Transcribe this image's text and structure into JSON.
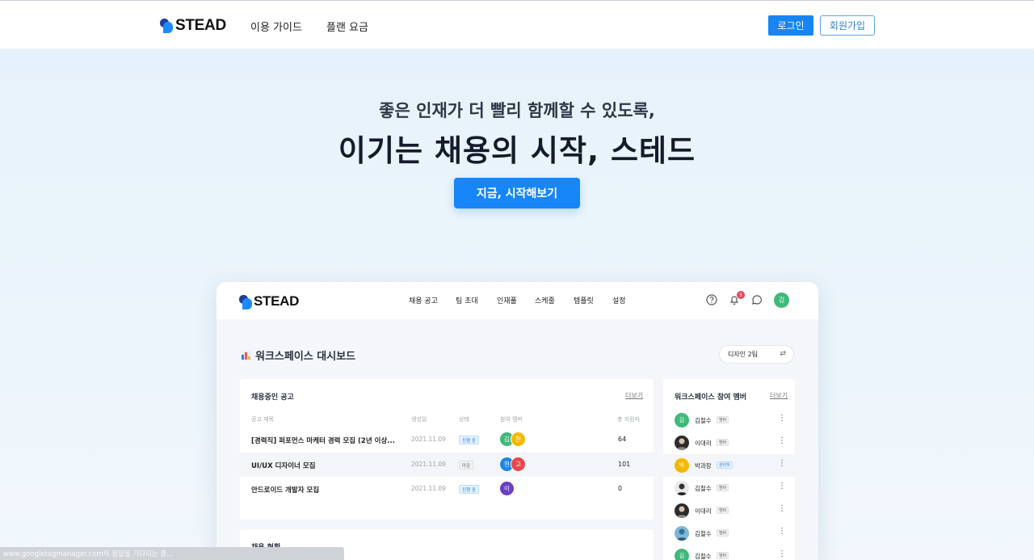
{
  "nav": {
    "logo_text": "STEAD",
    "links": [
      "이용 가이드",
      "플랜 요금"
    ],
    "login_label": "로그인",
    "signup_label": "회원가입"
  },
  "hero": {
    "subtitle": "좋은 인재가 더 빨리 함께할 수 있도록,",
    "headline": "이기는 채용의 시작, 스테드",
    "cta_label": "지금, 시작해보기"
  },
  "mockup": {
    "logo_text": "STEAD",
    "nav_links": [
      "채용 공고",
      "팀 초대",
      "인재풀",
      "스케줄",
      "템플릿",
      "설정"
    ],
    "notification_count": "5",
    "user_initial": "김",
    "dashboard_title": "워크스페이스 대시보드",
    "team_selector": "디자인 2팀",
    "jobs_card": {
      "title": "채용중인 공고",
      "more": "더보기",
      "headers": [
        "공고 제목",
        "생성일",
        "상태",
        "참여 멤버",
        "총 지원자"
      ],
      "rows": [
        {
          "title": "[경력직] 퍼포먼스 마케터 경력 모집 (2년 이상...",
          "date": "2021.11.09",
          "status": "진행 중",
          "members": [
            "김",
            "한"
          ],
          "applicants": "64"
        },
        {
          "title": "UI/UX 디자이너 모집",
          "date": "2021.11.09",
          "status": "마감",
          "members": [
            "현",
            "고"
          ],
          "applicants": "101"
        },
        {
          "title": "안드로이드 개발자 모집",
          "date": "2021.11.09",
          "status": "진행 중",
          "members": [
            "이"
          ],
          "applicants": "0"
        }
      ]
    },
    "members_card": {
      "title": "워크스페이스 참여 멤버",
      "more": "더보기",
      "members": [
        {
          "name": "김철수",
          "role": "멤버",
          "initial": "김"
        },
        {
          "name": "이대리",
          "role": "멤버",
          "initial": ""
        },
        {
          "name": "박과장",
          "role": "관리자",
          "initial": "박"
        },
        {
          "name": "김철수",
          "role": "멤버",
          "initial": ""
        },
        {
          "name": "이대리",
          "role": "멤버",
          "initial": ""
        },
        {
          "name": "김철수",
          "role": "멤버",
          "initial": ""
        },
        {
          "name": "김철수",
          "role": "멤버",
          "initial": "김"
        }
      ]
    },
    "status_card": {
      "title": "채용 현황"
    }
  },
  "status_bar": {
    "text": "www.googletagmanager.com의 응답을 기다리는 중..."
  },
  "colors": {
    "primary": "#1686f8",
    "dark_logo": "#1f3f9c",
    "alert": "#f0455a"
  }
}
